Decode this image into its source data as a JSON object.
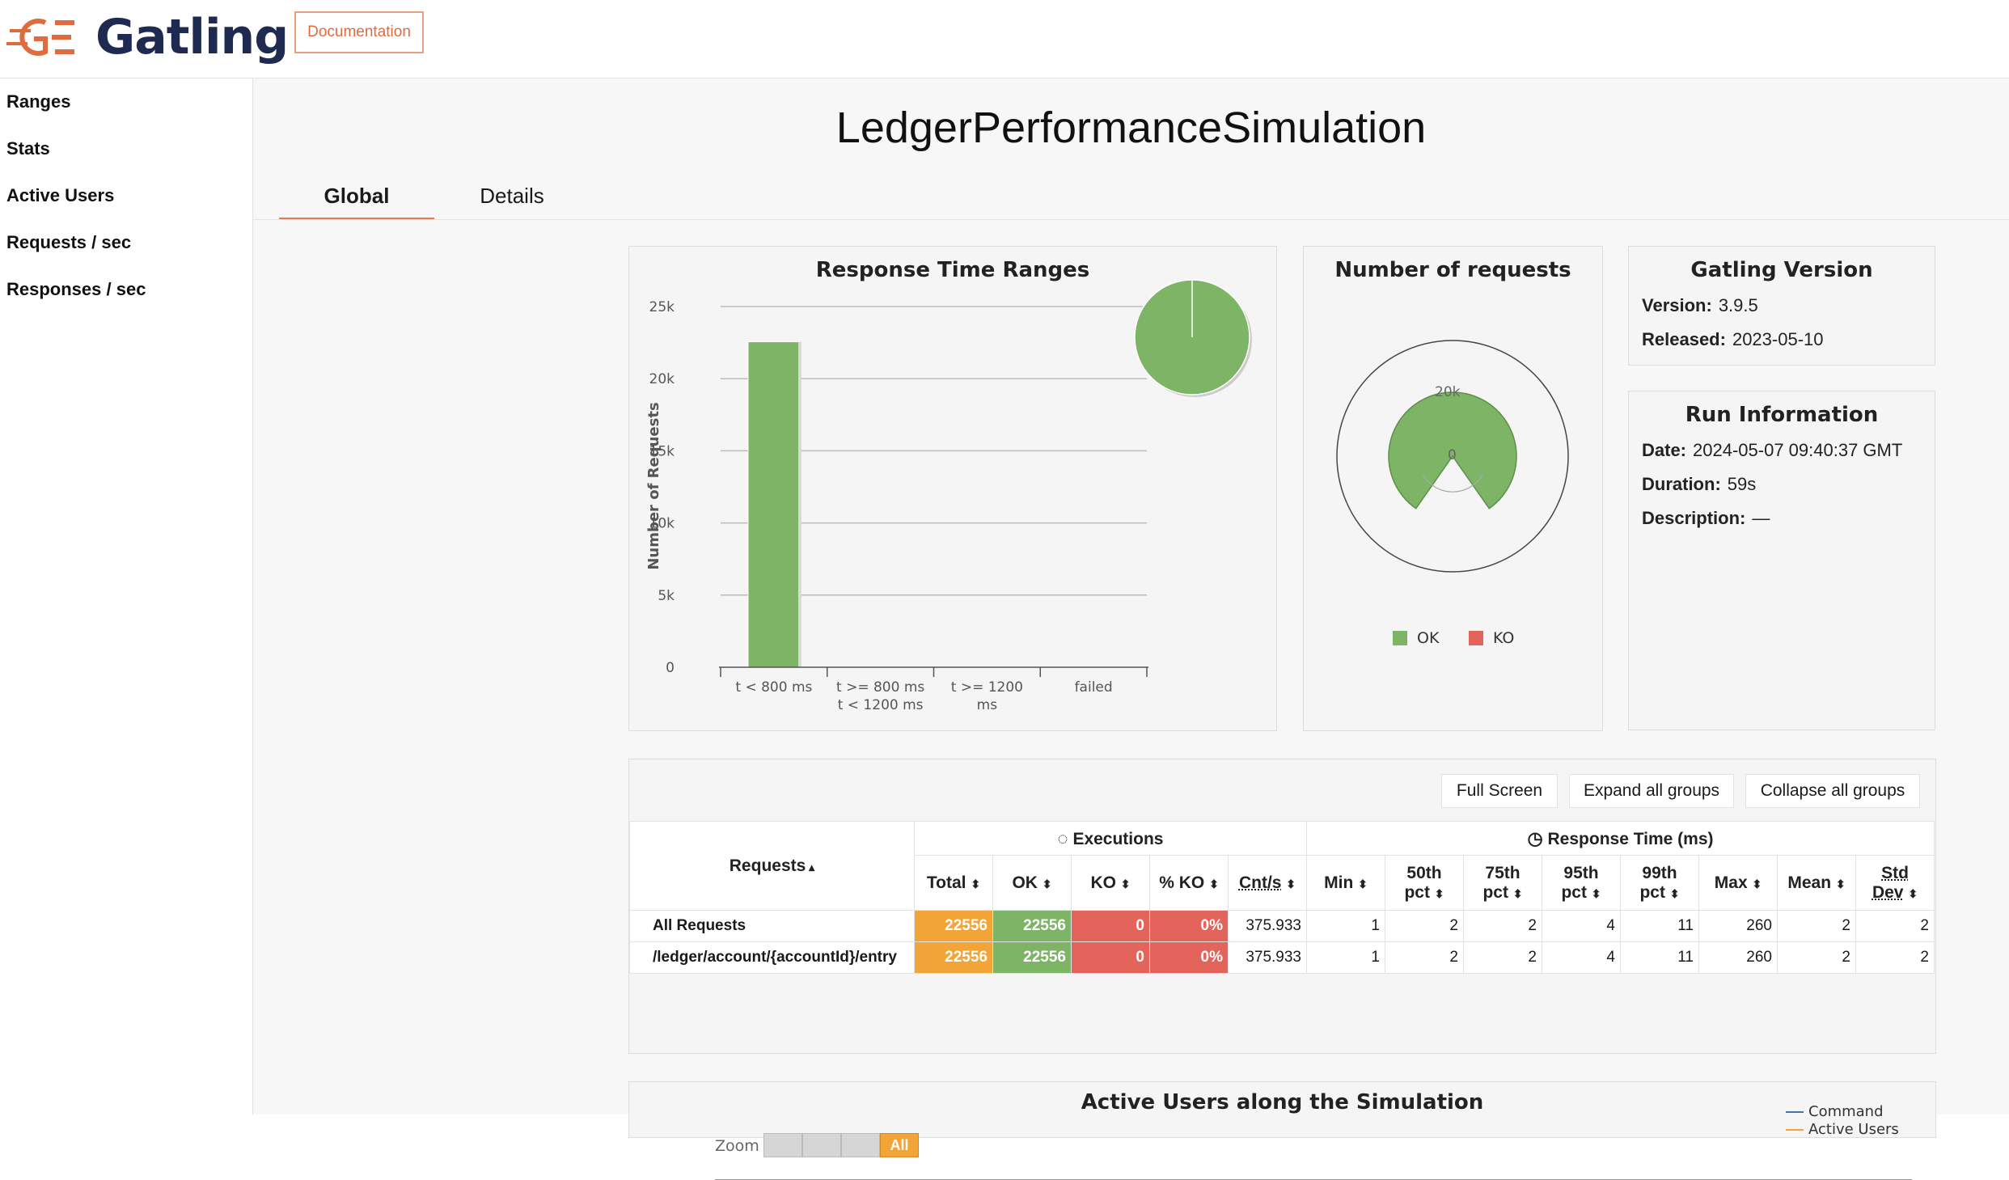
{
  "header": {
    "brand": "Gatling",
    "doc_button": "Documentation"
  },
  "sidebar": {
    "items": [
      {
        "label": "Ranges"
      },
      {
        "label": "Stats"
      },
      {
        "label": "Active Users"
      },
      {
        "label": "Requests / sec"
      },
      {
        "label": "Responses / sec"
      }
    ]
  },
  "main": {
    "title": "LedgerPerformanceSimulation",
    "tabs": [
      {
        "label": "Global",
        "active": true
      },
      {
        "label": "Details",
        "active": false
      }
    ]
  },
  "response_ranges": {
    "title": "Response Time Ranges",
    "ylabel": "Number of Requests",
    "yticks": [
      "0",
      "5k",
      "10k",
      "15k",
      "20k",
      "25k"
    ],
    "categories": [
      [
        "t < 800 ms"
      ],
      [
        "t >= 800 ms",
        "t < 1200 ms"
      ],
      [
        "t >= 1200",
        "ms"
      ],
      [
        "failed"
      ]
    ]
  },
  "number_of_requests": {
    "title": "Number of requests",
    "tick_top": "20k",
    "tick_center": "0",
    "legend": [
      {
        "label": "OK",
        "color": "#7eb466"
      },
      {
        "label": "KO",
        "color": "#e2645a"
      }
    ]
  },
  "chart_data": [
    {
      "type": "bar",
      "title": "Response Time Ranges",
      "ylabel": "Number of Requests",
      "categories": [
        "t < 800 ms",
        "t >= 800 ms t < 1200 ms",
        "t >= 1200 ms",
        "failed"
      ],
      "values": [
        22556,
        0,
        0,
        0
      ],
      "ylim": [
        0,
        25000
      ],
      "color": "#7eb466",
      "pie": {
        "values": [
          22556,
          0,
          0,
          0
        ]
      }
    },
    {
      "type": "pie",
      "title": "Number of requests",
      "categories": [
        "OK",
        "KO"
      ],
      "values": [
        22556,
        0
      ]
    }
  ],
  "gatling_version": {
    "title": "Gatling Version",
    "rows": [
      {
        "label": "Version:",
        "value": "3.9.5"
      },
      {
        "label": "Released:",
        "value": "2023-05-10"
      }
    ]
  },
  "run_info": {
    "title": "Run Information",
    "rows": [
      {
        "label": "Date:",
        "value": "2024-05-07 09:40:37 GMT"
      },
      {
        "label": "Duration:",
        "value": "59s"
      },
      {
        "label": "Description:",
        "value": "—"
      }
    ]
  },
  "stats": {
    "buttons": {
      "full_screen": "Full Screen",
      "expand": "Expand all groups",
      "collapse": "Collapse all groups"
    },
    "group_executions": "Executions",
    "group_response": "Response Time (ms)",
    "requests_header": "Requests",
    "columns": {
      "total": "Total",
      "ok": "OK",
      "ko": "KO",
      "pko": "% KO",
      "cnts": "Cnt/s",
      "min": "Min",
      "p50a": "50th",
      "p50b": "pct",
      "p75a": "75th",
      "p75b": "pct",
      "p95a": "95th",
      "p95b": "pct",
      "p99a": "99th",
      "p99b": "pct",
      "max": "Max",
      "mean": "Mean",
      "stda": "Std",
      "stdb": "Dev"
    },
    "rows": [
      {
        "name": "All Requests",
        "total": "22556",
        "ok": "22556",
        "ko": "0",
        "pko": "0%",
        "cnts": "375.933",
        "min": "1",
        "p50": "2",
        "p75": "2",
        "p95": "4",
        "p99": "11",
        "max": "260",
        "mean": "2",
        "std": "2"
      },
      {
        "name": "/ledger/account/{accountId}/entry",
        "total": "22556",
        "ok": "22556",
        "ko": "0",
        "pko": "0%",
        "cnts": "375.933",
        "min": "1",
        "p50": "2",
        "p75": "2",
        "p95": "4",
        "p99": "11",
        "max": "260",
        "mean": "2",
        "std": "2"
      }
    ]
  },
  "active_users": {
    "title": "Active Users along the Simulation",
    "zoom_label": "Zoom",
    "zoom_all": "All",
    "legend": [
      {
        "label": "Command",
        "color": "#4572a7"
      },
      {
        "label": "Active Users",
        "color": "#f2a437"
      }
    ]
  }
}
